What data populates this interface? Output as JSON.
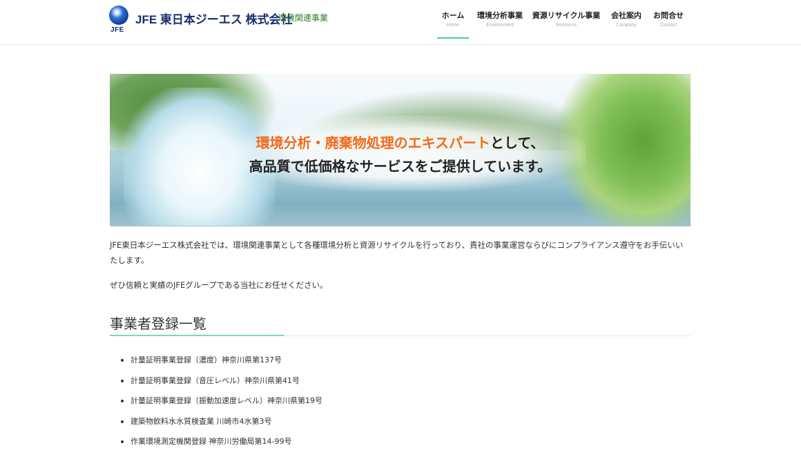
{
  "header": {
    "logo_mark": "JFE",
    "brand": "JFE 東日本ジーエス 株式会社",
    "division": "環境関連事業"
  },
  "nav": [
    {
      "label": "ホーム",
      "sub": "Home",
      "active": true
    },
    {
      "label": "環境分析事業",
      "sub": "Environment",
      "active": false
    },
    {
      "label": "資源リサイクル事業",
      "sub": "Resource",
      "active": false
    },
    {
      "label": "会社案内",
      "sub": "Company",
      "active": false
    },
    {
      "label": "お問合せ",
      "sub": "Contact",
      "active": false
    }
  ],
  "hero": {
    "line1_accent": "環境分析・廃棄物処理のエキスパート",
    "line1_rest": "として、",
    "line2": "高品質で低価格なサービスをご提供しています。",
    "accent_color": "#f26a1b"
  },
  "intro": {
    "p1": "JFE東日本ジーエス株式会社では、環境関連事業として各種環境分析と資源リサイクルを行っており、貴社の事業運営ならびにコンプライアンス遵守をお手伝いいたします。",
    "p2": "ぜひ信頼と実績のJFEグループである当社にお任せください。"
  },
  "registrations": {
    "title": "事業者登録一覧",
    "items": [
      "計量証明事業登録（濃度）神奈川県第137号",
      "計量証明事業登録（音圧レベル）神奈川県第41号",
      "計量証明事業登録（振動加速度レベル）神奈川県第19号",
      "建築物飲料水水質検査業 川崎市4水第3号",
      "作業環境測定機関登録 神奈川労働局第14-99号"
    ]
  },
  "colors": {
    "nav_active_underline": "#4cc9a5",
    "section_accent": "#7fd6bc",
    "brand_blue": "#1a2f6e",
    "division_green": "#2e7d32"
  }
}
